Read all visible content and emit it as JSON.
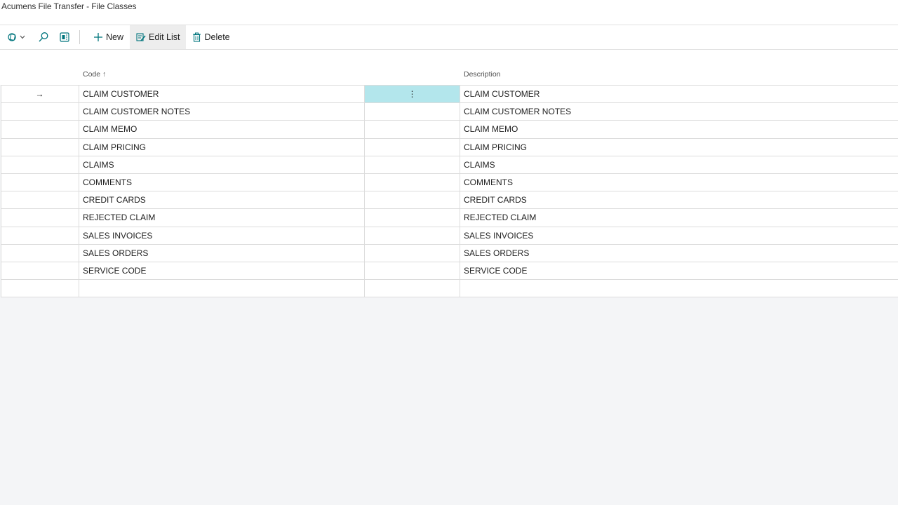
{
  "page": {
    "title": "Acumens File Transfer - File Classes"
  },
  "toolbar": {
    "new_label": "New",
    "edit_list_label": "Edit List",
    "delete_label": "Delete",
    "accent": "#00757d"
  },
  "grid": {
    "columns": {
      "code": "Code",
      "sort_indicator": "↑",
      "description": "Description"
    },
    "current_row_marker": "→",
    "row_menu_glyph": "⋮",
    "rows": [
      {
        "code": "CLAIM CUSTOMER",
        "description": "CLAIM CUSTOMER"
      },
      {
        "code": "CLAIM CUSTOMER NOTES",
        "description": "CLAIM CUSTOMER NOTES"
      },
      {
        "code": "CLAIM MEMO",
        "description": "CLAIM MEMO"
      },
      {
        "code": "CLAIM PRICING",
        "description": "CLAIM PRICING"
      },
      {
        "code": "CLAIMS",
        "description": "CLAIMS"
      },
      {
        "code": "COMMENTS",
        "description": "COMMENTS"
      },
      {
        "code": "CREDIT CARDS",
        "description": "CREDIT CARDS"
      },
      {
        "code": "REJECTED CLAIM",
        "description": "REJECTED CLAIM"
      },
      {
        "code": "SALES INVOICES",
        "description": "SALES INVOICES"
      },
      {
        "code": "SALES ORDERS",
        "description": "SALES ORDERS"
      },
      {
        "code": "SERVICE CODE",
        "description": "SERVICE CODE"
      },
      {
        "code": "",
        "description": ""
      }
    ],
    "highlight_color": "#b3e6ec"
  }
}
